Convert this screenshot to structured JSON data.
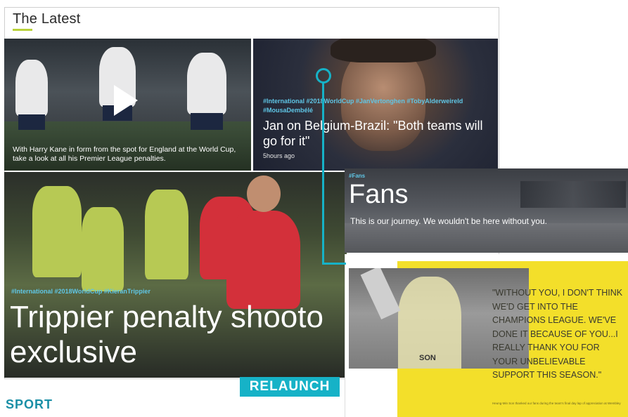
{
  "section": {
    "title": "The Latest"
  },
  "tiles": {
    "kane": {
      "caption": "With Harry Kane in form from the spot for England at the World Cup, take a look at all his Premier League penalties."
    },
    "jan": {
      "tags": "#International #2018WorldCup #JanVertonghen #TobyAlderweireld #MousaDembélé",
      "headline": "Jan on Belgium-Brazil: \"Both teams will go for it\"",
      "time": "5hours ago"
    },
    "trippier": {
      "tags": "#International #2018WorldCup #KieranTrippier",
      "headline": "Trippier penalty shooto exclusive"
    }
  },
  "fans_card": {
    "tag": "#Fans",
    "title": "Fans",
    "subtitle": "This is our journey. We wouldn't be here without you."
  },
  "quote_card": {
    "quote": "\"WITHOUT YOU, I DON'T THINK WE'D GET INTO THE CHAMPIONS LEAGUE. WE'VE DONE IT BECAUSE OF YOU...I REALLY THANK YOU FOR YOUR UNBELIEVABLE SUPPORT THIS SEASON.\"",
    "shirt_name": "SON",
    "caption": "Heung-Min Son thanked our fans during the team's final day lap of appreciation at Wembley"
  },
  "labels": {
    "relaunch": "RELAUNCH",
    "sport": "SPORT"
  },
  "colors": {
    "accent_teal": "#16b2c7",
    "underline_lime": "#b9d23a",
    "quote_yellow": "#f3df2a",
    "tag_blue": "#5fc6e6"
  },
  "icons": {
    "play": "play-icon"
  }
}
